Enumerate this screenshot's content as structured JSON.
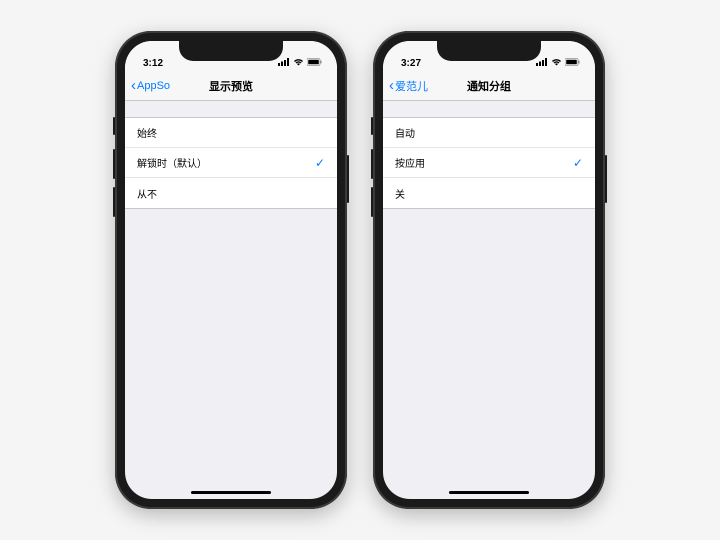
{
  "phones": [
    {
      "time": "3:12",
      "back_label": "AppSo",
      "title": "显示预览",
      "options": [
        {
          "label": "始终",
          "selected": false
        },
        {
          "label": "解锁时（默认）",
          "selected": true
        },
        {
          "label": "从不",
          "selected": false
        }
      ]
    },
    {
      "time": "3:27",
      "back_label": "爱范儿",
      "title": "通知分组",
      "options": [
        {
          "label": "自动",
          "selected": false
        },
        {
          "label": "按应用",
          "selected": true
        },
        {
          "label": "关",
          "selected": false
        }
      ]
    }
  ],
  "checkmark": "✓"
}
